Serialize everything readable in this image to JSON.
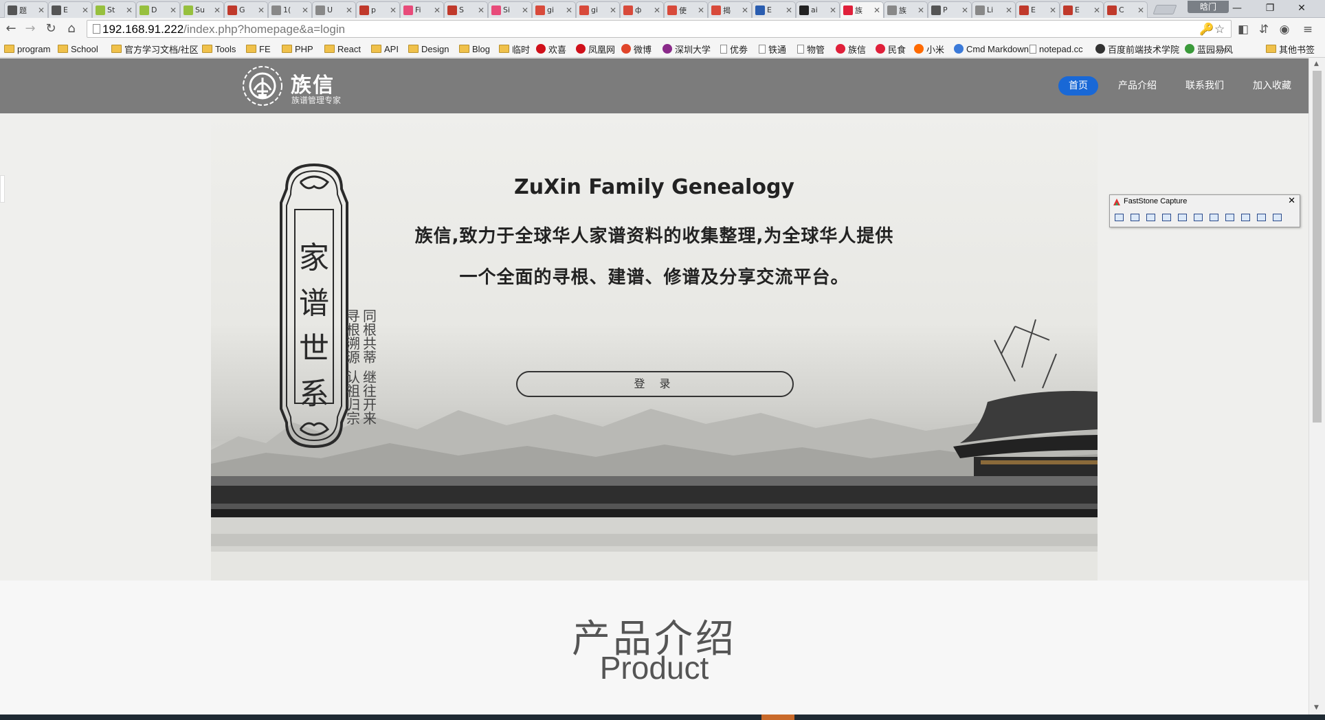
{
  "browser": {
    "tabs": [
      {
        "title": "题",
        "color": "#555555"
      },
      {
        "title": "E",
        "color": "#555555"
      },
      {
        "title": "St",
        "color": "#97c03e"
      },
      {
        "title": "D",
        "color": "#97c03e"
      },
      {
        "title": "Su",
        "color": "#97c03e"
      },
      {
        "title": "G",
        "color": "#c0392b"
      },
      {
        "title": "1(",
        "color": "#888888"
      },
      {
        "title": "U",
        "color": "#888888"
      },
      {
        "title": "p",
        "color": "#c0392b"
      },
      {
        "title": "Fi",
        "color": "#e84b7a"
      },
      {
        "title": "S",
        "color": "#c0392b"
      },
      {
        "title": "Si",
        "color": "#e84b7a"
      },
      {
        "title": "gi",
        "color": "#d84a3b"
      },
      {
        "title": "gi",
        "color": "#d84a3b"
      },
      {
        "title": "ф",
        "color": "#d84a3b"
      },
      {
        "title": "使",
        "color": "#d84a3b"
      },
      {
        "title": "揭",
        "color": "#d84a3b"
      },
      {
        "title": "E",
        "color": "#2a5db0"
      },
      {
        "title": "ai",
        "color": "#222222"
      },
      {
        "title": "族",
        "color": "#e0203a"
      },
      {
        "title": "族",
        "color": "#888888"
      },
      {
        "title": "P",
        "color": "#555555"
      },
      {
        "title": "Li",
        "color": "#888888"
      },
      {
        "title": "E",
        "color": "#c0392b"
      },
      {
        "title": "E",
        "color": "#c0392b"
      },
      {
        "title": "C",
        "color": "#c0392b"
      }
    ],
    "active_tab_index": 19,
    "profile_label": "晗门",
    "url_host": "192.168.91.222",
    "url_path": "/index.php?homepage&a=login",
    "bookmarks": [
      {
        "label": "program",
        "icon": "folder"
      },
      {
        "label": "School",
        "icon": "folder"
      },
      {
        "label": "官方学习文档/社区",
        "icon": "folder"
      },
      {
        "label": "Tools",
        "icon": "folder"
      },
      {
        "label": "FE",
        "icon": "folder"
      },
      {
        "label": "PHP",
        "icon": "folder"
      },
      {
        "label": "React",
        "icon": "folder"
      },
      {
        "label": "API",
        "icon": "folder"
      },
      {
        "label": "Design",
        "icon": "folder"
      },
      {
        "label": "Blog",
        "icon": "folder"
      },
      {
        "label": "临时",
        "icon": "folder"
      },
      {
        "label": "欢喜",
        "icon": "red-round"
      },
      {
        "label": "凤凰网",
        "icon": "phoenix"
      },
      {
        "label": "微博",
        "icon": "weibo"
      },
      {
        "label": "深圳大学",
        "icon": "purple-round"
      },
      {
        "label": "优劵",
        "icon": "page"
      },
      {
        "label": "铁通",
        "icon": "page"
      },
      {
        "label": "物管",
        "icon": "page"
      },
      {
        "label": "族信",
        "icon": "red-p"
      },
      {
        "label": "民食",
        "icon": "red-p"
      },
      {
        "label": "小米",
        "icon": "mi"
      },
      {
        "label": "Cmd Markdown",
        "icon": "blue-round"
      },
      {
        "label": "notepad.cc",
        "icon": "notepad"
      },
      {
        "label": "百度前端技术学院",
        "icon": "dark-round"
      },
      {
        "label": "蓝园易风",
        "icon": "green-round"
      }
    ],
    "bookmarks_overflow": "»",
    "other_bookmarks": "其他书签"
  },
  "site": {
    "brand": "族信",
    "brand_sub": "族谱管理专家",
    "nav": [
      "首页",
      "产品介绍",
      "联系我们",
      "加入收藏"
    ],
    "nav_active_index": 0,
    "accent": "#1968d6",
    "header_bg": "#7c7c7c"
  },
  "hero": {
    "title": "ZuXin Family Genealogy",
    "line1": "族信,致力于全球华人家谱资料的收集整理,为全球华人提供",
    "line2": "一个全面的寻根、建谱、修谱及分享交流平台。",
    "login_label": "登 录",
    "plaque_text": "家谱世系",
    "couplet_right_top": "寻根溯源",
    "couplet_right_bottom": "认祖归宗",
    "couplet_left_top": "同根共蒂",
    "couplet_left_bottom": "继往开来"
  },
  "products": {
    "title_cn": "产品介绍",
    "title_en": "Product"
  },
  "faststone": {
    "title": "FastStone Capture",
    "close": "✕"
  }
}
